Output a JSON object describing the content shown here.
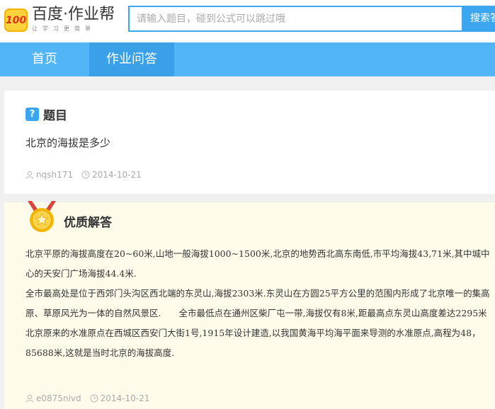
{
  "header": {
    "logo_badge": "100",
    "logo_title": "百度·作业帮",
    "logo_slogan": "让学习更简单",
    "search_placeholder": "请输入题目，碰到公式可以跳过哦",
    "search_button": "搜索答案"
  },
  "nav": {
    "items": [
      {
        "label": "首页"
      },
      {
        "label": "作业问答"
      }
    ]
  },
  "question": {
    "icon_glyph": "?",
    "label": "题目",
    "text": "北京的海拔是多少",
    "user": "nqsh171",
    "date": "2014-10-21"
  },
  "answer": {
    "label": "优质解答",
    "paragraphs": [
      "北京平原的海拔高度在20~60米,山地一般海拔1000~1500米,北京的地势西北高东南低,市平均海拔43,71米,其中城中心的天安门广场海拔44.4米.",
      "全市最高处是位于西郊门头沟区西北端的东灵山,海拔2303米.东灵山在方圆25平方公里的范围内形成了北京唯一的集高原、草原风光为一体的自然风景区.　　全市最低点在通州区柴厂屯一带,海拔仅有8米,距最高点东灵山高度差达2295米",
      "北京原来的水准原点在西城区西安门大街1号,1915年设计建造,以我国黄海平均海平面来导测的水准原点,高程为48，85688米,这就是当时北京的海拔高度."
    ],
    "user": "e0875nivd",
    "date": "2014-10-21"
  },
  "colors": {
    "accent": "#3ca7f0",
    "nav_bg": "#52b5f5",
    "nav_active": "#3aa0e8",
    "answer_bg": "#fffbea",
    "medal_gold": "#f5b800",
    "ribbon_red": "#d9443c"
  },
  "icons": {
    "user": "user-icon",
    "time": "clock-icon",
    "medal": "medal-icon",
    "question": "question-icon"
  }
}
